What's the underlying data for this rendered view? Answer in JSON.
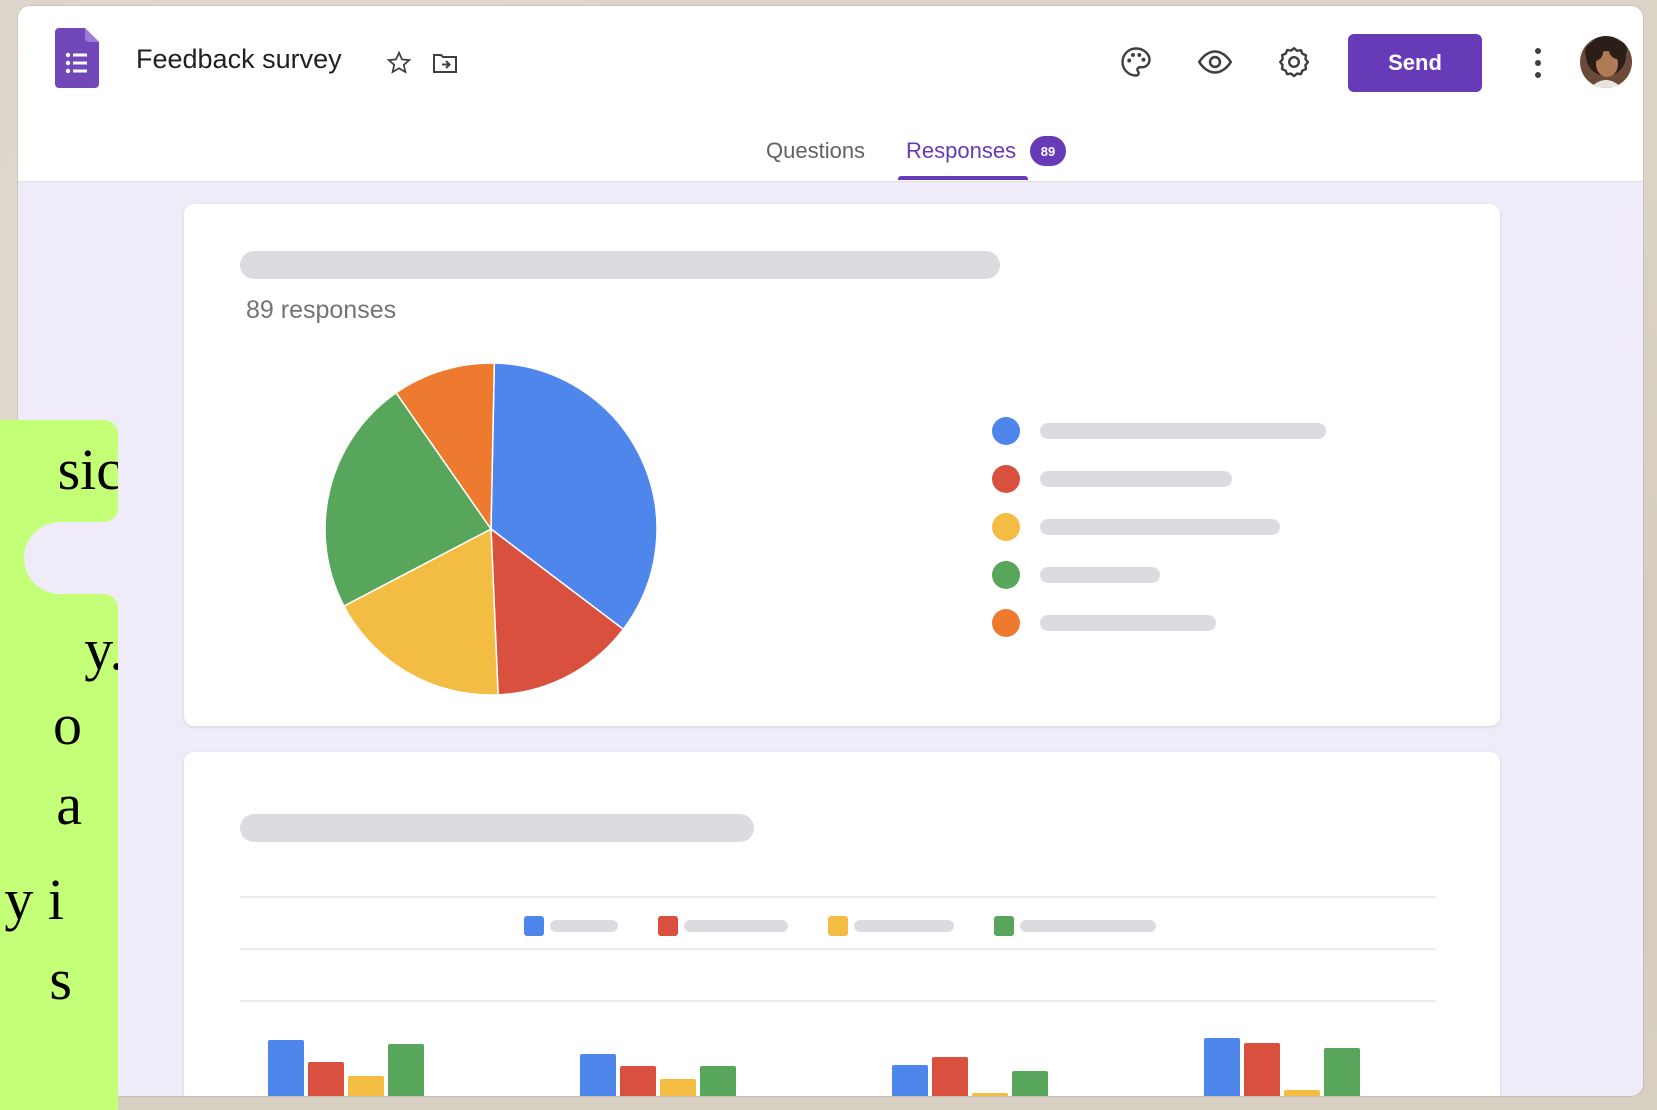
{
  "header": {
    "title": "Feedback survey",
    "send_label": "Send",
    "icons": [
      "star-icon",
      "move-to-folder-icon",
      "palette-icon",
      "preview-eye-icon",
      "settings-gear-icon",
      "more-vert-icon"
    ]
  },
  "tabs": {
    "questions_label": "Questions",
    "responses_label": "Responses",
    "responses_badge": "89"
  },
  "summary": {
    "response_count": "89 responses"
  },
  "colors": {
    "accent": "#673ab7",
    "blue": "#4f86ec",
    "red": "#d9503f",
    "yellow": "#f2bd42",
    "green": "#58a65c",
    "orange": "#ee7a30"
  },
  "overlay_text": [
    "sic",
    "y.",
    "o",
    "a",
    "y i",
    "s"
  ],
  "chart_data": [
    {
      "type": "pie",
      "slice_colors": [
        "#4f86ec",
        "#d9503f",
        "#f2bd42",
        "#58a65c",
        "#ee7a30"
      ],
      "values": [
        35,
        14,
        18,
        23,
        10
      ]
    },
    {
      "type": "bar",
      "series_colors": [
        "#4f86ec",
        "#d9503f",
        "#f2bd42",
        "#58a65c"
      ],
      "groups": [
        [
          72,
          50,
          36,
          68
        ],
        [
          58,
          46,
          33,
          46
        ],
        [
          47,
          55,
          19,
          41
        ],
        [
          74,
          69,
          22,
          64
        ]
      ]
    }
  ]
}
